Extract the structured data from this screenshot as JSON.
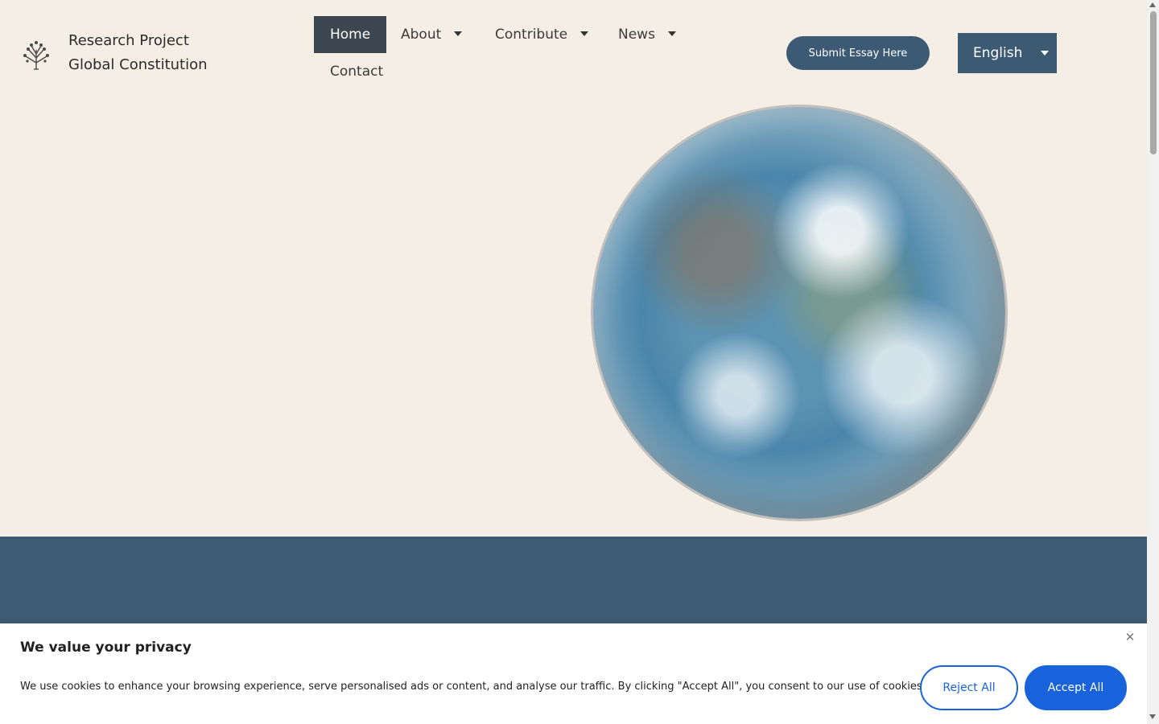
{
  "header": {
    "brand_line1": "Research Project",
    "brand_line2": "Global Constitution",
    "logo_icon": "tree-icon"
  },
  "nav": {
    "items": [
      {
        "label": "Home",
        "active": true
      },
      {
        "label": "About",
        "has_dropdown": true
      },
      {
        "label": "Contribute",
        "has_dropdown": true
      },
      {
        "label": "News",
        "has_dropdown": true
      },
      {
        "label": "Contact"
      }
    ]
  },
  "actions": {
    "submit_label": "Submit Essay Here",
    "language_selected": "English"
  },
  "hero": {
    "image": "globe-earth-image"
  },
  "cookie": {
    "title": "We value your privacy",
    "text": "We use cookies to enhance your browsing experience, serve personalised ads or content, and analyse our traffic. By clicking \"Accept All\", you consent to our use of cookies.",
    "reject_label": "Reject All",
    "accept_label": "Accept All"
  },
  "colors": {
    "background": "#f5eee5",
    "primary": "#3c5a74",
    "nav_active": "#3c4650",
    "cookie_accent": "#1863dc"
  }
}
